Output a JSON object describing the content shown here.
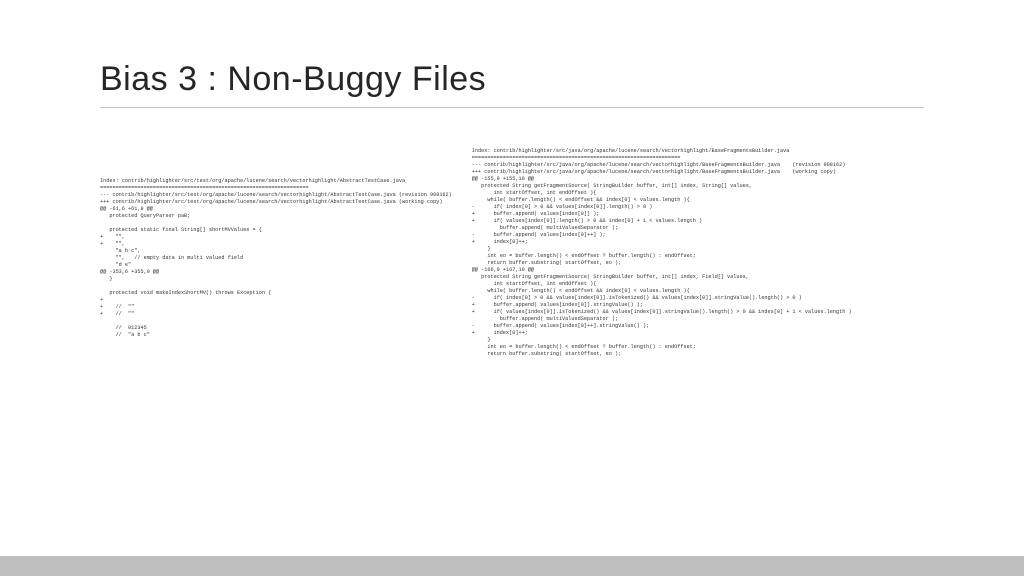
{
  "title": "Bias 3 : Non-Buggy Files",
  "diff_left": "Index: contrib/highlighter/src/test/org/apache/lucene/search/vectorhighlight/AbstractTestCase.java\n===================================================================\n--- contrib/highlighter/src/test/org/apache/lucene/search/vectorhighlight/AbstractTestCase.java (revision 908162)\n+++ contrib/highlighter/src/test/org/apache/lucene/search/vectorhighlight/AbstractTestCase.java (working copy)\n@@ -61,6 +61,8 @@\n   protected QueryParser paB;\n \n   protected static final String[] shortMVValues = {\n+    \"\",\n+    \"\",\n     \"a b c\",\n     \"\",   // empty data in multi valued field\n     \"d e\"\n@@ -353,6 +355,9 @@\n   }\n \n   protected void makeIndexShortMV() throws Exception {\n+\n+    //  \"\"\n+    //  \"\"\n \n     //  012345\n     //  \"a b c\"",
  "diff_right": "Index: contrib/highlighter/src/java/org/apache/lucene/search/vectorhighlight/BaseFragmentsBuilder.java\n===================================================================\n--- contrib/highlighter/src/java/org/apache/lucene/search/vectorhighlight/BaseFragmentsBuilder.java    (revision 908162)\n+++ contrib/highlighter/src/java/org/apache/lucene/search/vectorhighlight/BaseFragmentsBuilder.java    (working copy)\n@@ -155,9 +155,10 @@\n   protected String getFragmentSource( StringBuilder buffer, int[] index, String[] values,\n       int startOffset, int endOffset ){\n     while( buffer.length() < endOffset && index[0] < values.length ){\n-      if( index[0] > 0 && values[index[0]].length() > 0 )\n+      buffer.append( values[index[0]] );\n+      if( values[index[0]].length() > 0 && index[0] + 1 < values.length )\n         buffer.append( multiValuedSeparator );\n-      buffer.append( values[index[0]++] );\n+      index[0]++;\n     }\n     int eo = buffer.length() < endOffset ? buffer.length() : endOffset;\n     return buffer.substring( startOffset, eo );\n@@ -166,9 +167,10 @@\n   protected String getFragmentSource( StringBuilder buffer, int[] index, Field[] values,\n       int startOffset, int endOffset ){\n     while( buffer.length() < endOffset && index[0] < values.length ){\n-      if( index[0] > 0 && values[index[0]].isTokenized() && values[index[0]].stringValue().length() > 0 )\n+      buffer.append( values[index[0]].stringValue() );\n+      if( values[index[0]].isTokenized() && values[index[0]].stringValue().length() > 0 && index[0] + 1 < values.length )\n         buffer.append( multiValuedSeparator );\n-      buffer.append( values[index[0]++].stringValue() );\n+      index[0]++;\n     }\n     int eo = buffer.length() < endOffset ? buffer.length() : endOffset;\n     return buffer.substring( startOffset, eo );"
}
